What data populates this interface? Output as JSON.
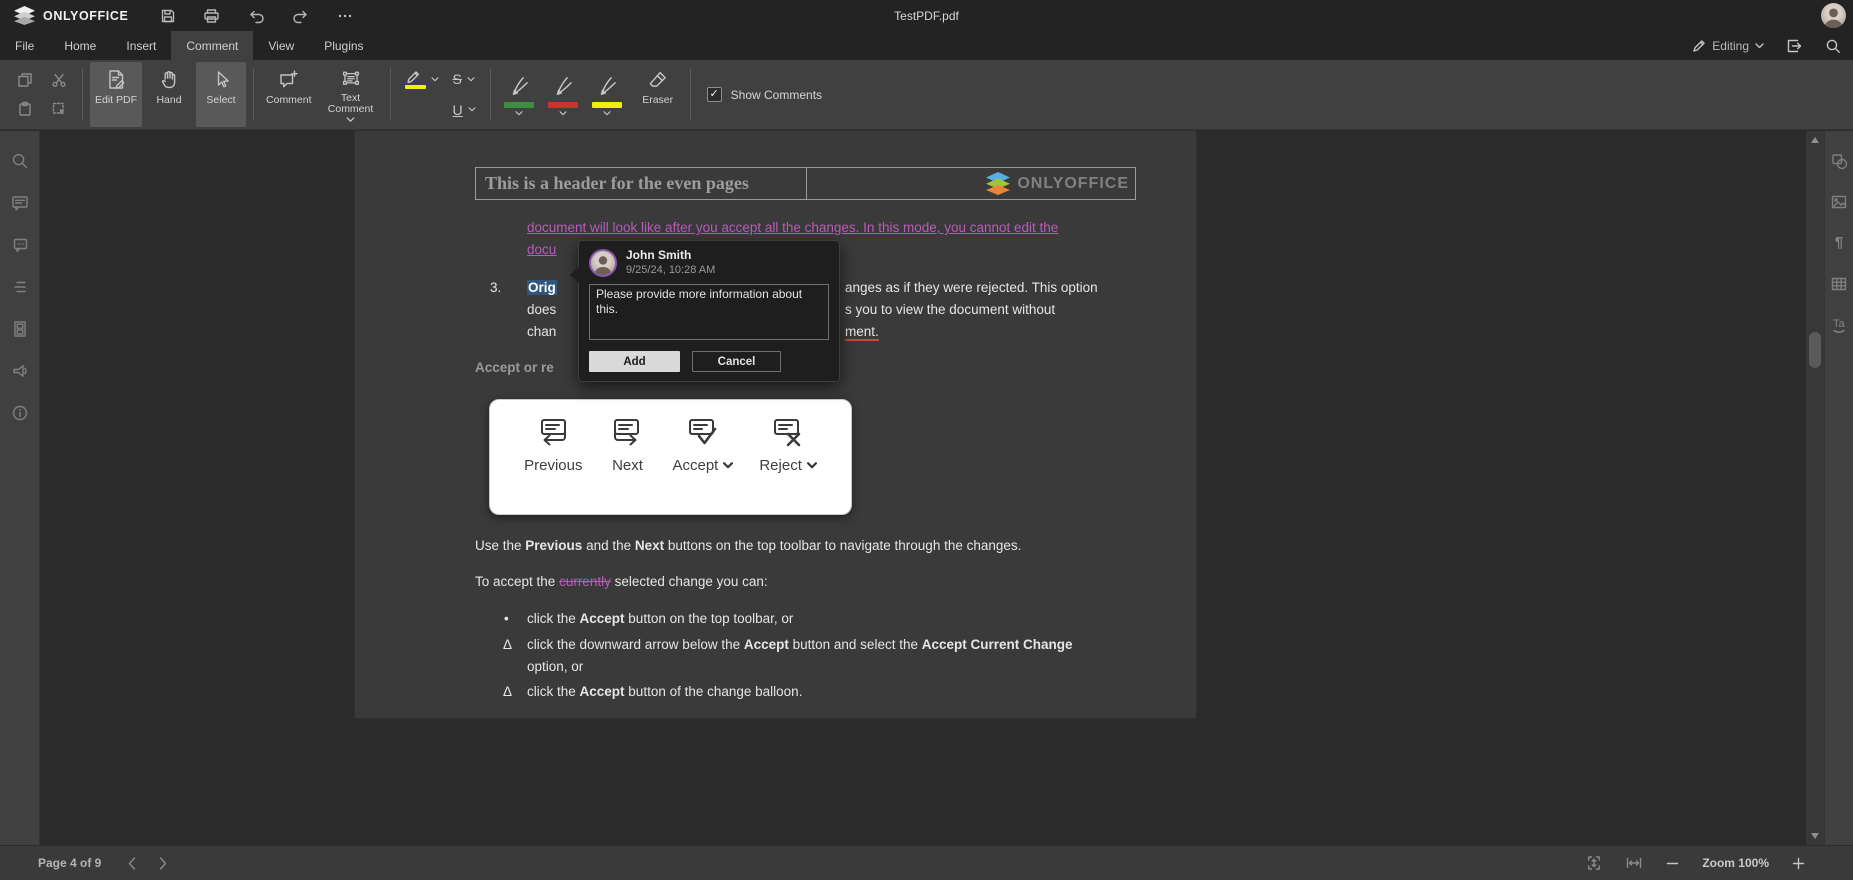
{
  "titlebar": {
    "logo_text": "ONLYOFFICE",
    "title": "TestPDF.pdf"
  },
  "menubar": {
    "tabs": [
      "File",
      "Home",
      "Insert",
      "Comment",
      "View",
      "Plugins"
    ],
    "active_tab": "Comment",
    "editing_label": "Editing"
  },
  "toolbar": {
    "edit_pdf": "Edit PDF",
    "hand": "Hand",
    "select": "Select",
    "comment": "Comment",
    "text_comment": "Text Comment",
    "strike_glyph": "S",
    "underline_glyph": "U",
    "eraser": "Eraser",
    "show_comments": "Show Comments",
    "show_comments_check": "✓",
    "pen_colors": {
      "highlight": "#f2ec10",
      "green": "#3e8e41",
      "red": "#c9342b",
      "yellow": "#f2ec10"
    }
  },
  "left_sidebar": {
    "icons": [
      "search-icon",
      "comments-icon",
      "chat-icon",
      "navigation-icon",
      "page-thumbnails-icon",
      "feedback-icon",
      "about-icon"
    ]
  },
  "right_sidebar": {
    "icons": [
      "shape-settings-icon",
      "image-settings-icon",
      "paragraph-settings-icon",
      "table-settings-icon",
      "textart-settings-icon"
    ]
  },
  "comment_popup": {
    "author": "John Smith",
    "timestamp": "9/25/24, 10:28 AM",
    "text": "Please provide more information about this.",
    "add_label": "Add",
    "cancel_label": "Cancel"
  },
  "document": {
    "header": {
      "text": "This is a header for the even pages",
      "logo_text": "ONLYOFFICE"
    },
    "inserted_line1": "document will look like after you accept all the changes. In this mode, you cannot edit the",
    "inserted_line2": "docu",
    "item3": {
      "number": "3.",
      "left1": "Orig",
      "right1": "anges as if they were rejected. This option",
      "left2": "does",
      "right2": "s you to view the document without",
      "left3": "chan",
      "right3": "ment."
    },
    "heading": "Accept or re",
    "nav_panel": {
      "previous": "Previous",
      "next": "Next",
      "accept": "Accept",
      "reject": "Reject"
    },
    "p_nav": {
      "t1": "Use the ",
      "b1": "Previous",
      "t2": " and the ",
      "b2": "Next",
      "t3": " buttons on the top toolbar to navigate through the changes."
    },
    "p_accept": {
      "t1": "To accept the ",
      "deleted": "currently",
      "t2": " selected change you can:"
    },
    "bullets": [
      {
        "marker": "•",
        "t1": "click the ",
        "b1": "Accept",
        "t2": " button on the top toolbar, or",
        "b2": "",
        "line2": ""
      },
      {
        "marker": "Δ",
        "t1": "click the downward arrow below the ",
        "b1": "Accept",
        "t2": " button and select the ",
        "b2": "Accept Current Change",
        "line2": "option, or"
      },
      {
        "marker": "Δ",
        "t1": "click the ",
        "b1": "Accept",
        "t2": " button of the change balloon.",
        "b2": "",
        "line2": ""
      }
    ]
  },
  "statusbar": {
    "page_label": "Page 4 of 9",
    "zoom_label": "Zoom 100%"
  },
  "colors": {
    "accent_purple": "#b85cb8",
    "selection_blue": "#31567e",
    "pen_green": "#3e8e41",
    "pen_red": "#c9342b",
    "pen_yellow": "#f2ec10",
    "logo_blue": "#56b0e3",
    "logo_green": "#a0c53c",
    "logo_orange": "#e8853d",
    "toolbar_bg": "#404040",
    "topbar_bg": "#232323",
    "page_bg": "#3a3a3a"
  }
}
